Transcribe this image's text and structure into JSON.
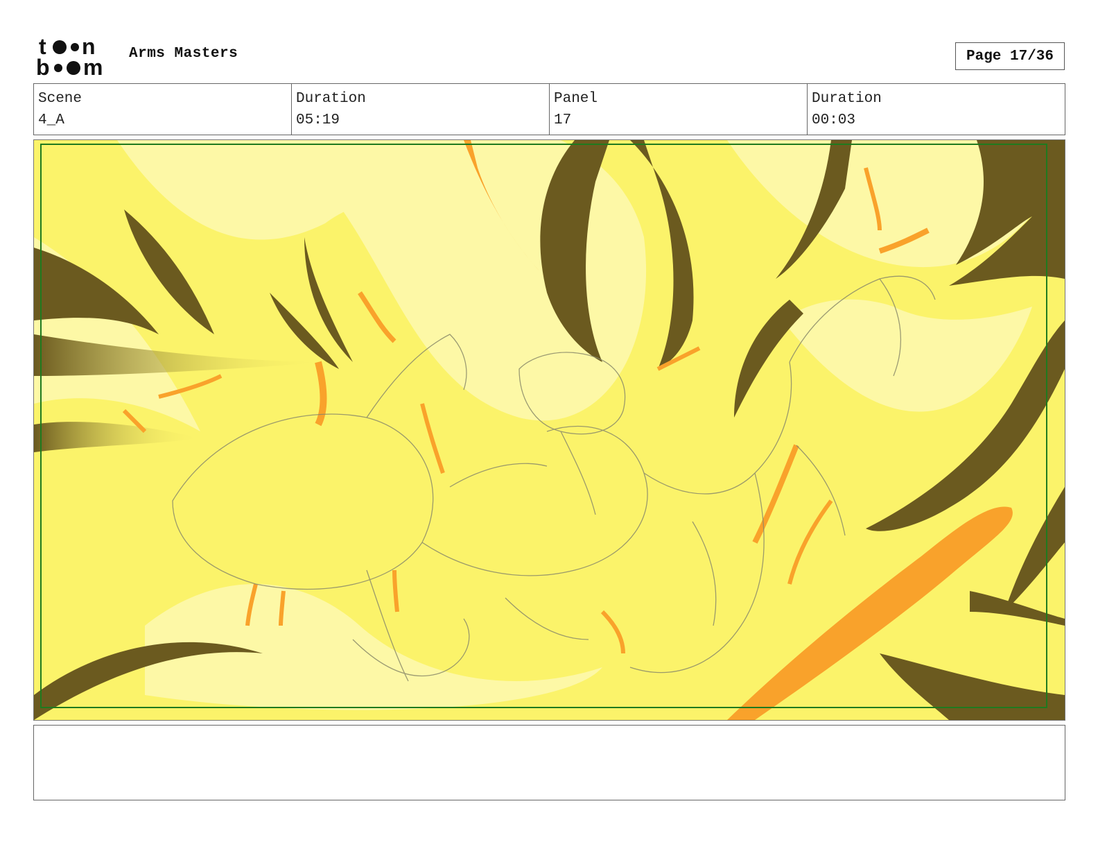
{
  "header": {
    "logo_text": "toon boom",
    "project_title": "Arms Masters",
    "page_label": "Page 17/36"
  },
  "info": {
    "scene_label": "Scene",
    "scene_value": "4_A",
    "scene_duration_label": "Duration",
    "scene_duration_value": "05:19",
    "panel_label": "Panel",
    "panel_value": "17",
    "panel_duration_label": "Duration",
    "panel_duration_value": "00:03"
  },
  "colors": {
    "background_yellow": "#fbf36a",
    "light_yellow": "#fdf8a6",
    "dark_olive": "#6b5a1f",
    "orange": "#f9a22b",
    "safe_frame_green": "#1f7a1f"
  },
  "notes": {
    "text": ""
  }
}
